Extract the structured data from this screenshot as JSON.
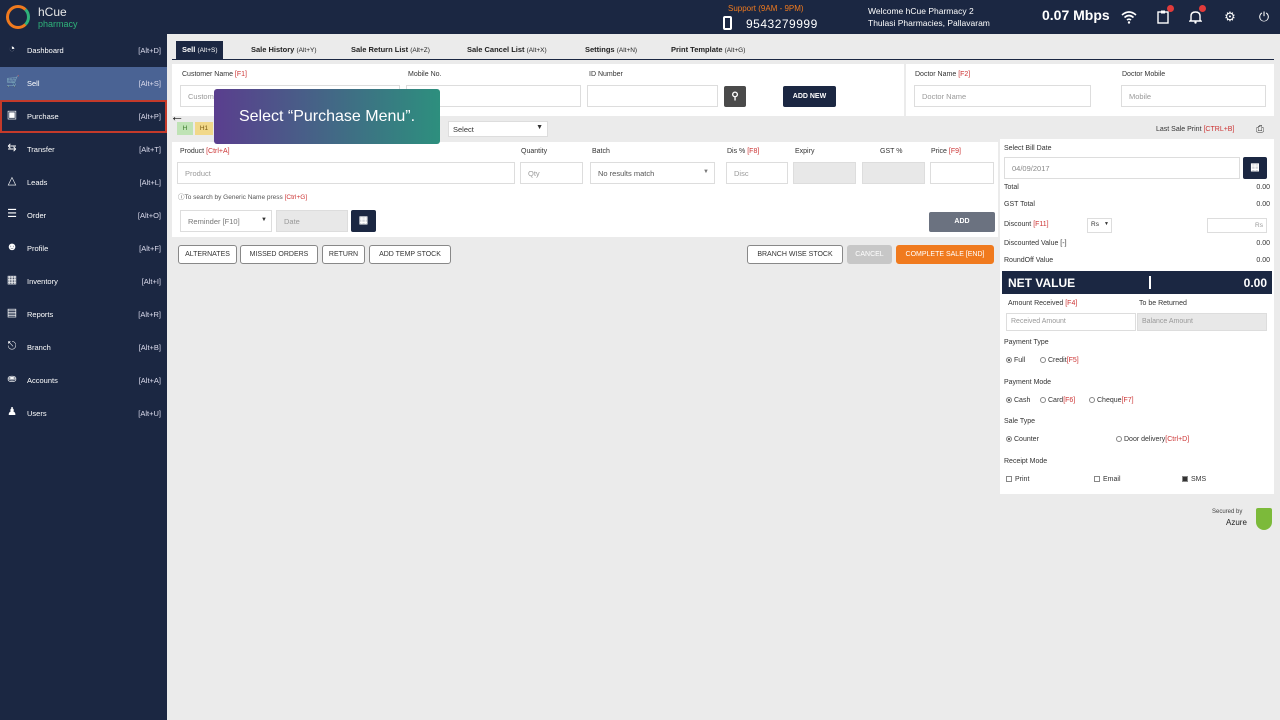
{
  "app": {
    "brand_line1": "hCue",
    "brand_line2": "pharmacy"
  },
  "topbar": {
    "support_label": "Support (9AM - 9PM)",
    "support_phone": "9543279999",
    "welcome_line1": "Welcome hCue Pharmacy 2",
    "welcome_line2": "Thulasi Pharmacies, Pallavaram",
    "speed": "0.07 Mbps",
    "icons": [
      "wifi-icon",
      "clipboard-icon",
      "bell-icon",
      "gear-icon",
      "power-icon"
    ],
    "badge_color": "#e23b3b"
  },
  "sidebar": {
    "items": [
      {
        "label": "Dashboard",
        "key": "[Alt+D]",
        "icon": "dashboard-icon"
      },
      {
        "label": "Sell",
        "key": "[Alt+S]",
        "icon": "cart-icon"
      },
      {
        "label": "Purchase",
        "key": "[Alt+P]",
        "icon": "purchase-icon"
      },
      {
        "label": "Transfer",
        "key": "[Alt+T]",
        "icon": "transfer-icon"
      },
      {
        "label": "Leads",
        "key": "[Alt+L]",
        "icon": "leads-icon"
      },
      {
        "label": "Order",
        "key": "[Alt+O]",
        "icon": "order-icon"
      },
      {
        "label": "Profile",
        "key": "[Alt+F]",
        "icon": "profile-icon"
      },
      {
        "label": "Inventory",
        "key": "[Alt+I]",
        "icon": "inventory-icon"
      },
      {
        "label": "Reports",
        "key": "[Alt+R]",
        "icon": "reports-icon"
      },
      {
        "label": "Branch",
        "key": "[Alt+B]",
        "icon": "branch-icon"
      },
      {
        "label": "Accounts",
        "key": "[Alt+A]",
        "icon": "lock-icon"
      },
      {
        "label": "Users",
        "key": "[Alt+U]",
        "icon": "users-icon"
      }
    ]
  },
  "tabs": [
    {
      "label": "Sell",
      "key": "(Alt+S)"
    },
    {
      "label": "Sale History",
      "key": "(Alt+Y)"
    },
    {
      "label": "Sale Return List",
      "key": "(Alt+Z)"
    },
    {
      "label": "Sale Cancel List",
      "key": "(Alt+X)"
    },
    {
      "label": "Settings",
      "key": "(Alt+N)"
    },
    {
      "label": "Print Template",
      "key": "(Alt+G)"
    }
  ],
  "customer": {
    "name_label": "Customer Name",
    "name_key": "[F1]",
    "name_placeholder": "Customer",
    "mobile_label": "Mobile No.",
    "id_label": "ID Number",
    "add_new": "ADD NEW",
    "doctor_label": "Doctor Name",
    "doctor_key": "[F2]",
    "doctor_placeholder": "Doctor Name",
    "doctor_mobile_label": "Doctor Mobile",
    "doctor_mobile_placeholder": "Mobile",
    "tag1": "H",
    "tag2": "H1",
    "select_value": "Select",
    "last_sale_label": "Last Sale Print",
    "last_sale_key": "[CTRL+B]"
  },
  "product": {
    "product_label": "Product",
    "product_key": "[Ctrl+A]",
    "product_placeholder": "Product",
    "qty_label": "Quantity",
    "qty_placeholder": "Qty",
    "batch_label": "Batch",
    "batch_value": "No results match",
    "disc_label": "Dis %",
    "disc_key": "[F8]",
    "disc_placeholder": "Disc",
    "expiry_label": "Expiry",
    "gst_label": "GST %",
    "price_label": "Price",
    "price_key": "[F9]",
    "hint": "To search by Generic Name press",
    "hint_key": "[Ctrl+G]",
    "reminder": "Reminder [F10]",
    "date_placeholder": "Date",
    "add_button": "ADD"
  },
  "actions": {
    "alternates": "ALTERNATES",
    "missed": "MISSED ORDERS",
    "return": "RETURN",
    "temp": "ADD TEMP STOCK",
    "branch_stock": "BRANCH WISE STOCK",
    "cancel": "CANCEL",
    "complete": "COMPLETE SALE [END]",
    "complete_color": "#f07a1e"
  },
  "summary": {
    "bill_date_label": "Select Bill Date",
    "bill_date": "04/09/2017",
    "total_label": "Total",
    "total": "0.00",
    "gst_label": "GST Total",
    "gst": "0.00",
    "discount_label": "Discount",
    "discount_key": "[F11]",
    "discount_unit": "Rs",
    "discount_placeholder": "Rs",
    "discounted_label": "Discounted Value [-]",
    "discounted": "0.00",
    "roundoff_label": "RoundOff Value",
    "roundoff": "0.00",
    "net_label": "NET VALUE",
    "net": "0.00",
    "received_label": "Amount Received",
    "received_key": "[F4]",
    "received_placeholder": "Received Amount",
    "returned_label": "To be Returned",
    "returned_placeholder": "Balance Amount",
    "payment_type_label": "Payment Type",
    "pt_full": "Full",
    "pt_credit": "Credit",
    "pt_credit_key": "[F5]",
    "payment_mode_label": "Payment Mode",
    "pm_cash": "Cash",
    "pm_card": "Card",
    "pm_card_key": "[F6]",
    "pm_cheque": "Cheque",
    "pm_cheque_key": "[F7]",
    "sale_type_label": "Sale Type",
    "st_counter": "Counter",
    "st_door": "Door delivery",
    "st_door_key": "[Ctrl+D]",
    "receipt_label": "Receipt Mode",
    "rm_print": "Print",
    "rm_email": "Email",
    "rm_sms": "SMS"
  },
  "tooltip": {
    "text": "Select “Purchase Menu”."
  },
  "footer": {
    "secured": "Secured by",
    "azure": "Azure"
  }
}
